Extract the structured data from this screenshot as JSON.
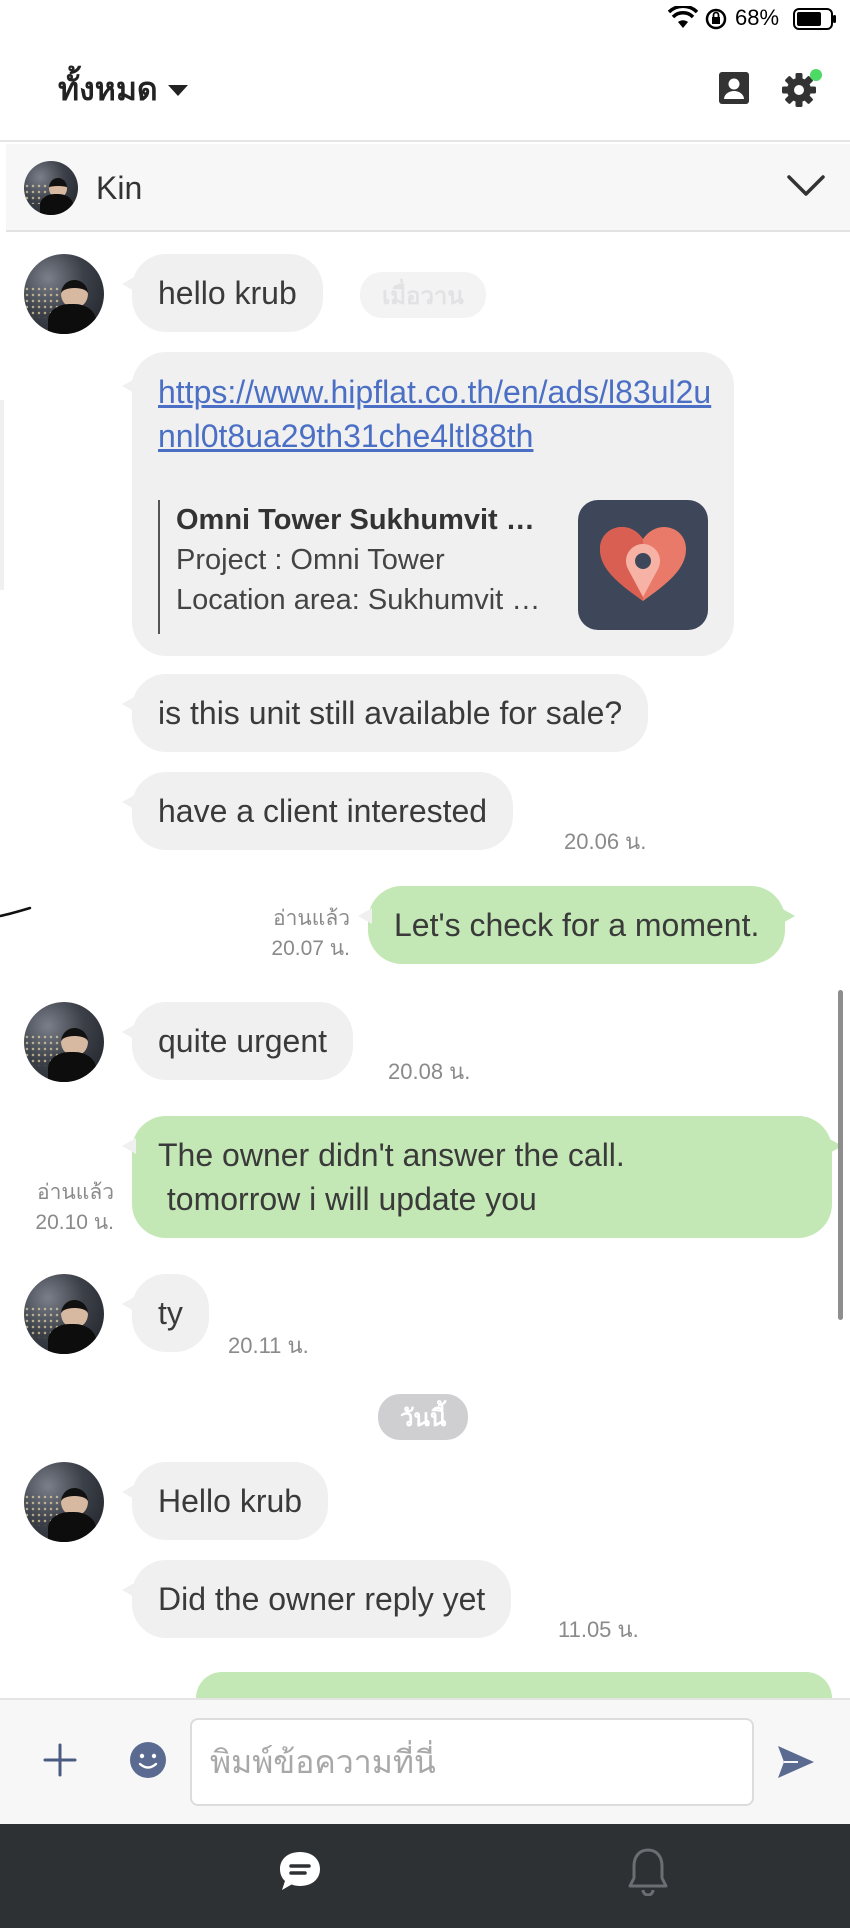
{
  "status_bar": {
    "battery": "68%",
    "icons": [
      "wifi-icon",
      "orientation-lock-icon",
      "battery-icon"
    ]
  },
  "header": {
    "filter_label": "ทั้งหมด",
    "icons": [
      "contacts-icon",
      "settings-icon"
    ]
  },
  "contact": {
    "name": "Kin"
  },
  "messages": {
    "m1": {
      "text": "hello krub",
      "time": "เมื่อวาน"
    },
    "link": {
      "url": "https://www.hipflat.co.th/en/ads/l83ul2unnl0t8ua29th31che4ltl88th",
      "title": "Omni Tower Sukhumvit Nana",
      "line1": "Project : Omni Tower",
      "line2": "Location area: Sukhumvit Nana"
    },
    "m2": {
      "text": "is this unit still available for sale?"
    },
    "m3": {
      "text": "have a client interested",
      "time": "20.06 น."
    },
    "m4": {
      "text": "Let's check for a moment.",
      "read": "อ่านแล้ว",
      "time": "20.07 น."
    },
    "m5": {
      "text": "quite urgent",
      "time": "20.08 น."
    },
    "m6": {
      "line1": "The owner didn't answer the call.",
      "line2": " tomorrow i will update you",
      "read": "อ่านแล้ว",
      "time": "20.10 น."
    },
    "m7": {
      "text": "ty",
      "time": "20.11 น."
    },
    "date_today": "วันนี้",
    "m8": {
      "text": "Hello krub"
    },
    "m9": {
      "text": "Did the owner reply yet",
      "time": "11.05 น."
    }
  },
  "composer": {
    "placeholder": "พิมพ์ข้อความที่นี่"
  },
  "colors": {
    "sent_bubble": "#c3e8b5",
    "received_bubble": "#f0f0f1",
    "link": "#4a6fc4",
    "nav_bg": "#2e3133",
    "settings_dot": "#4cd964"
  }
}
